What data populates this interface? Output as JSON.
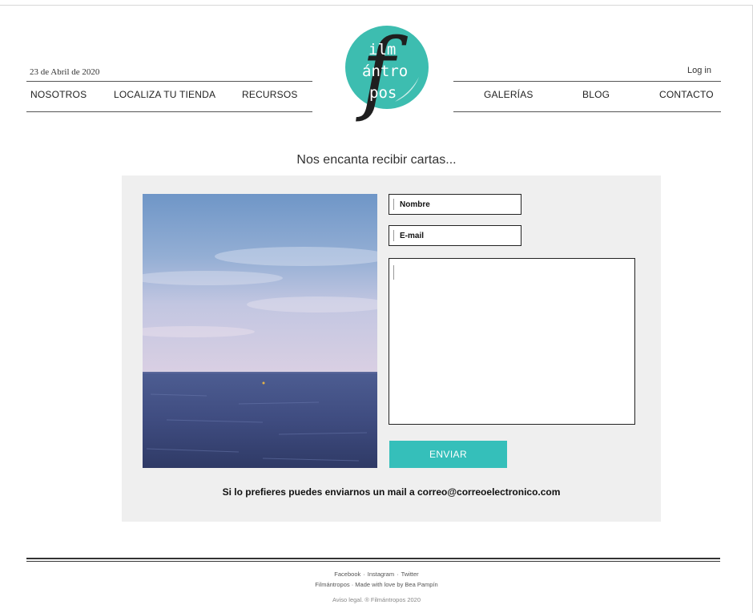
{
  "header": {
    "date": "23 de Abril de 2020",
    "login_label": "Log in",
    "nav_left": [
      "NOSOTROS",
      "LOCALIZA TU TIENDA",
      "RECURSOS"
    ],
    "nav_right": [
      "GALERÍAS",
      "BLOG",
      "CONTACTO"
    ]
  },
  "logo": {
    "initial": "f",
    "lines": [
      "ilm",
      "ántro",
      "pos"
    ],
    "color": "#3dbdb0"
  },
  "contact": {
    "headline": "Nos encanta recibir cartas...",
    "name_placeholder": "Nombre",
    "email_placeholder": "E-mail",
    "message_value": "",
    "submit_label": "ENVIAR",
    "mail_note": "Si lo prefieres puedes enviarnos un mail a correo@correoelectronico.com",
    "accent_color": "#35bfba"
  },
  "footer": {
    "social": [
      "Facebook",
      "Instagram",
      "Twitter"
    ],
    "separator": "·",
    "credit": "Filmántropos · Made with love by Bea Pampín",
    "legal": "Aviso legal. ® Filmántropos 2020"
  }
}
